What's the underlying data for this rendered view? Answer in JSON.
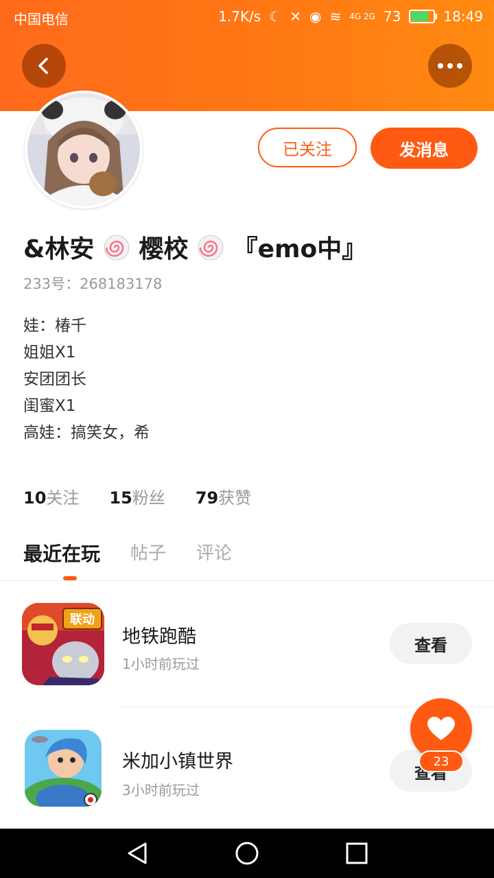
{
  "status_bar": {
    "carrier": "中国电信",
    "net_speed": "1.7K/s",
    "signal_label": "4G 2G",
    "battery_pct": "73",
    "time": "18:49"
  },
  "profile": {
    "username_prefix": "&林安",
    "username_mid": "樱校",
    "username_suffix": "『emo中』",
    "uid": "233号：268183178",
    "bio": [
      "娃：椿千",
      "姐姐X1",
      "安团团长",
      "闺蜜X1",
      "高娃：搞笑女，希"
    ]
  },
  "actions": {
    "follow_label": "已关注",
    "message_label": "发消息"
  },
  "stats": [
    {
      "num": "10",
      "label": "关注"
    },
    {
      "num": "15",
      "label": "粉丝"
    },
    {
      "num": "79",
      "label": "获赞"
    }
  ],
  "tabs": [
    "最近在玩",
    "帖子",
    "评论"
  ],
  "games": [
    {
      "name": "地铁跑酷",
      "time": "1小时前玩过",
      "button": "查看",
      "badge": "联动"
    },
    {
      "name": "米加小镇世界",
      "time": "3小时前玩过",
      "button": "查看"
    }
  ],
  "fab": {
    "count": "23"
  },
  "colors": {
    "accent": "#ff5a12",
    "header": "#ff7a14"
  }
}
